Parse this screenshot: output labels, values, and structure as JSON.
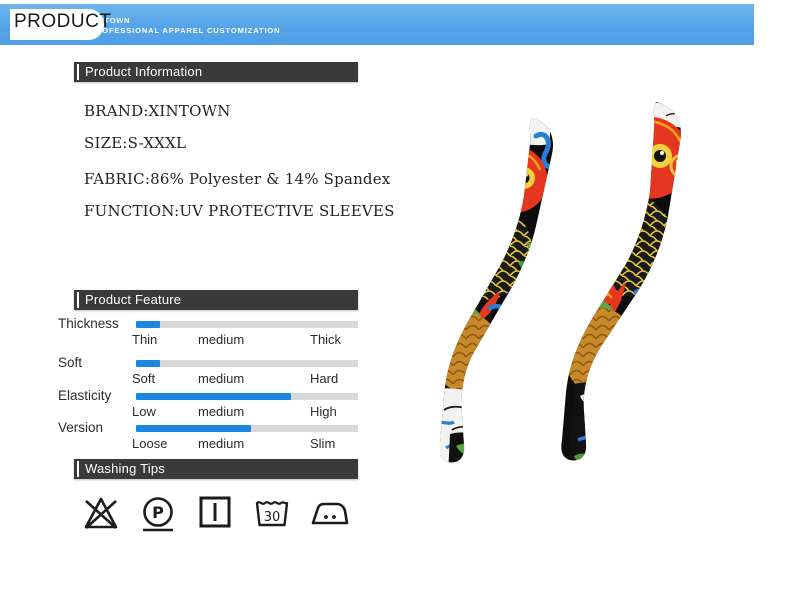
{
  "header": {
    "plate_text": "PRODUCT",
    "brand": "XINTOWN",
    "tagline": "PROFESSIONAL APPAREL CUSTOMIZATION",
    "band_color": "#55a4ea"
  },
  "sections": {
    "information_title": "Product Information",
    "feature_title": "Product Feature",
    "washing_title": "Washing Tips",
    "bar_color": "#3a3a3a"
  },
  "information": {
    "lines": [
      "BRAND:XINTOWN",
      "SIZE:S-XXXL",
      "FABRIC:86% Polyester & 14% Spandex",
      "FUNCTION:UV PROTECTIVE SLEEVES"
    ]
  },
  "features": {
    "accent_color": "#1b86e0",
    "track_color": "#d8d8d8",
    "rows": [
      {
        "name": "Thickness",
        "low": "Thin",
        "mid": "medium",
        "high": "Thick",
        "percent": 11
      },
      {
        "name": "Soft",
        "low": "Soft",
        "mid": "medium",
        "high": "Hard",
        "percent": 11
      },
      {
        "name": "Elasticity",
        "low": "Low",
        "mid": "medium",
        "high": "High",
        "percent": 70
      },
      {
        "name": "Version",
        "low": "Loose",
        "mid": "medium",
        "high": "Slim",
        "percent": 52
      }
    ]
  },
  "washing": {
    "icons": [
      {
        "name": "do-not-bleach-icon",
        "label": ""
      },
      {
        "name": "dry-clean-p-icon",
        "label": "P"
      },
      {
        "name": "drip-dry-icon",
        "label": ""
      },
      {
        "name": "machine-wash-30-icon",
        "label": "30"
      },
      {
        "name": "iron-two-dots-icon",
        "label": ""
      }
    ]
  },
  "product_photo": {
    "alt": "tattoo-print-arm-sleeves-koi-fish"
  }
}
